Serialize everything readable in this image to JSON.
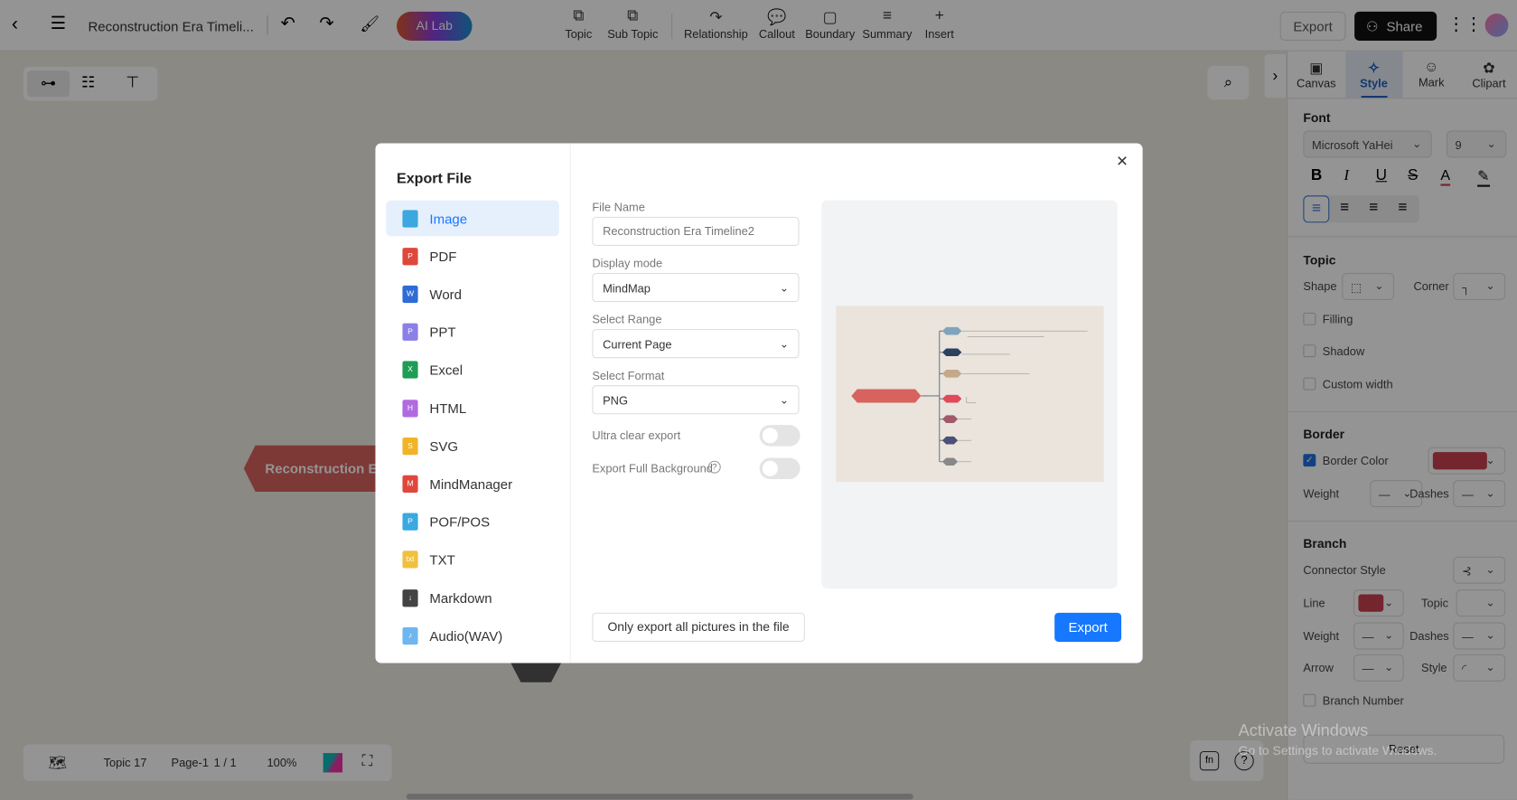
{
  "topbar": {
    "title": "Reconstruction Era Timeli...",
    "ai_lab": "AI Lab",
    "tools": [
      {
        "label": "Topic",
        "icon": "topic-icon",
        "glyph": "⧉"
      },
      {
        "label": "Sub Topic",
        "icon": "subtopic-icon",
        "glyph": "⧉"
      },
      {
        "label": "Relationship",
        "icon": "relationship-icon",
        "glyph": "↷"
      },
      {
        "label": "Callout",
        "icon": "callout-icon",
        "glyph": "💬"
      },
      {
        "label": "Boundary",
        "icon": "boundary-icon",
        "glyph": "▢"
      },
      {
        "label": "Summary",
        "icon": "summary-icon",
        "glyph": "≡"
      },
      {
        "label": "Insert",
        "icon": "plus-icon",
        "glyph": "+"
      }
    ],
    "export": "Export",
    "share": "Share"
  },
  "canvas": {
    "root_topic": "Reconstruction Era"
  },
  "bottombar": {
    "topic_count": "Topic 17",
    "page": "Page-1",
    "page_of": "1 / 1",
    "zoom": "100%"
  },
  "right_panel": {
    "tabs": [
      "Canvas",
      "Style",
      "Mark",
      "Clipart"
    ],
    "active_tab": "Style",
    "font": {
      "title": "Font",
      "family": "Microsoft YaHei",
      "size": "9"
    },
    "topic": {
      "title": "Topic",
      "shape": "Shape",
      "corner": "Corner",
      "filling": "Filling",
      "shadow": "Shadow",
      "custom_width": "Custom width"
    },
    "border": {
      "title": "Border",
      "color_label": "Border Color",
      "color": "#c8404f",
      "weight": "Weight",
      "dashes": "Dashes"
    },
    "branch": {
      "title": "Branch",
      "connector": "Connector Style",
      "line": "Line",
      "line_color": "#c8404f",
      "topic": "Topic",
      "weight": "Weight",
      "dashes": "Dashes",
      "arrow": "Arrow",
      "style": "Style",
      "branch_number": "Branch Number"
    },
    "reset": "Reset"
  },
  "watermark": {
    "line1": "Activate Windows",
    "line2": "Go to Settings to activate Windows."
  },
  "dialog": {
    "title": "Export File",
    "formats": [
      {
        "label": "Image",
        "color": "#3ba8e0",
        "tag": ""
      },
      {
        "label": "PDF",
        "color": "#e0473c",
        "tag": "P"
      },
      {
        "label": "Word",
        "color": "#2f6bd6",
        "tag": "W"
      },
      {
        "label": "PPT",
        "color": "#8b7fe8",
        "tag": "P"
      },
      {
        "label": "Excel",
        "color": "#1f9d55",
        "tag": "X"
      },
      {
        "label": "HTML",
        "color": "#b06be0",
        "tag": "H"
      },
      {
        "label": "SVG",
        "color": "#f0b429",
        "tag": "S"
      },
      {
        "label": "MindManager",
        "color": "#e0473c",
        "tag": "M"
      },
      {
        "label": "POF/POS",
        "color": "#3ba8e0",
        "tag": "P"
      },
      {
        "label": "TXT",
        "color": "#f0c040",
        "tag": "txt"
      },
      {
        "label": "Markdown",
        "color": "#444444",
        "tag": "↓"
      },
      {
        "label": "Audio(WAV)",
        "color": "#6fb6f0",
        "tag": "♪"
      }
    ],
    "selected_format": "Image",
    "file_name_label": "File Name",
    "file_name_placeholder": "Reconstruction Era Timeline2",
    "display_mode_label": "Display mode",
    "display_mode": "MindMap",
    "range_label": "Select Range",
    "range": "Current Page",
    "format_label": "Select Format",
    "format": "PNG",
    "ultra_clear": "Ultra clear export",
    "ultra_clear_on": false,
    "full_bg": "Export Full Background",
    "full_bg_on": false,
    "only_pictures": "Only export all pictures in the file",
    "export": "Export",
    "accent": "#1677ff"
  }
}
